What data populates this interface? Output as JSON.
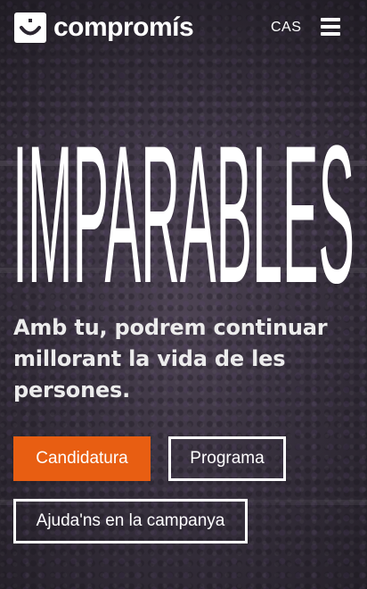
{
  "header": {
    "brand": "compromís",
    "language_label": "CAS"
  },
  "hero": {
    "title": "IMPARABLES",
    "subtitle": "Amb tu, podrem continuar millorant la vida de les persones."
  },
  "buttons": {
    "candidatura": "Candidatura",
    "programa": "Programa",
    "campanya": "Ajuda'ns en la campanya"
  },
  "icons": {
    "logo": "smiley-logo-icon",
    "menu": "hamburger-menu-icon"
  },
  "colors": {
    "accent": "#e85e12",
    "text": "#ffffff"
  }
}
